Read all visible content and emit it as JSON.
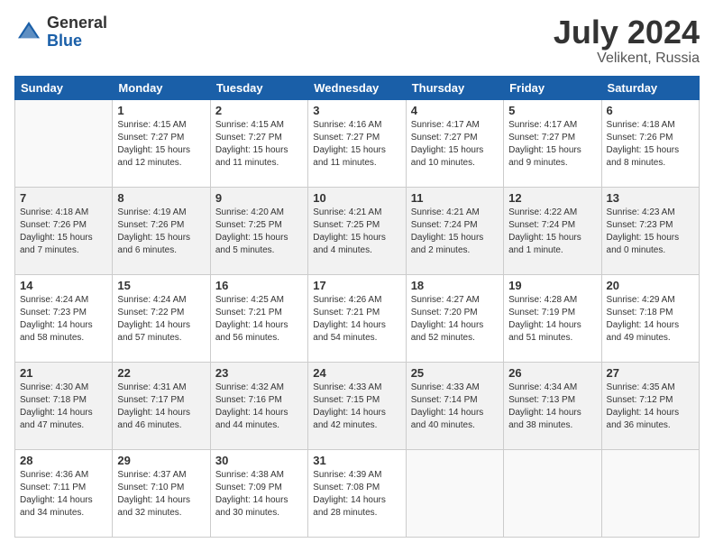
{
  "header": {
    "logo_general": "General",
    "logo_blue": "Blue",
    "title": "July 2024",
    "subtitle": "Velikent, Russia"
  },
  "days": [
    "Sunday",
    "Monday",
    "Tuesday",
    "Wednesday",
    "Thursday",
    "Friday",
    "Saturday"
  ],
  "weeks": [
    [
      {
        "day": "",
        "info": ""
      },
      {
        "day": "1",
        "info": "Sunrise: 4:15 AM\nSunset: 7:27 PM\nDaylight: 15 hours\nand 12 minutes."
      },
      {
        "day": "2",
        "info": "Sunrise: 4:15 AM\nSunset: 7:27 PM\nDaylight: 15 hours\nand 11 minutes."
      },
      {
        "day": "3",
        "info": "Sunrise: 4:16 AM\nSunset: 7:27 PM\nDaylight: 15 hours\nand 11 minutes."
      },
      {
        "day": "4",
        "info": "Sunrise: 4:17 AM\nSunset: 7:27 PM\nDaylight: 15 hours\nand 10 minutes."
      },
      {
        "day": "5",
        "info": "Sunrise: 4:17 AM\nSunset: 7:27 PM\nDaylight: 15 hours\nand 9 minutes."
      },
      {
        "day": "6",
        "info": "Sunrise: 4:18 AM\nSunset: 7:26 PM\nDaylight: 15 hours\nand 8 minutes."
      }
    ],
    [
      {
        "day": "7",
        "info": "Sunrise: 4:18 AM\nSunset: 7:26 PM\nDaylight: 15 hours\nand 7 minutes."
      },
      {
        "day": "8",
        "info": "Sunrise: 4:19 AM\nSunset: 7:26 PM\nDaylight: 15 hours\nand 6 minutes."
      },
      {
        "day": "9",
        "info": "Sunrise: 4:20 AM\nSunset: 7:25 PM\nDaylight: 15 hours\nand 5 minutes."
      },
      {
        "day": "10",
        "info": "Sunrise: 4:21 AM\nSunset: 7:25 PM\nDaylight: 15 hours\nand 4 minutes."
      },
      {
        "day": "11",
        "info": "Sunrise: 4:21 AM\nSunset: 7:24 PM\nDaylight: 15 hours\nand 2 minutes."
      },
      {
        "day": "12",
        "info": "Sunrise: 4:22 AM\nSunset: 7:24 PM\nDaylight: 15 hours\nand 1 minute."
      },
      {
        "day": "13",
        "info": "Sunrise: 4:23 AM\nSunset: 7:23 PM\nDaylight: 15 hours\nand 0 minutes."
      }
    ],
    [
      {
        "day": "14",
        "info": "Sunrise: 4:24 AM\nSunset: 7:23 PM\nDaylight: 14 hours\nand 58 minutes."
      },
      {
        "day": "15",
        "info": "Sunrise: 4:24 AM\nSunset: 7:22 PM\nDaylight: 14 hours\nand 57 minutes."
      },
      {
        "day": "16",
        "info": "Sunrise: 4:25 AM\nSunset: 7:21 PM\nDaylight: 14 hours\nand 56 minutes."
      },
      {
        "day": "17",
        "info": "Sunrise: 4:26 AM\nSunset: 7:21 PM\nDaylight: 14 hours\nand 54 minutes."
      },
      {
        "day": "18",
        "info": "Sunrise: 4:27 AM\nSunset: 7:20 PM\nDaylight: 14 hours\nand 52 minutes."
      },
      {
        "day": "19",
        "info": "Sunrise: 4:28 AM\nSunset: 7:19 PM\nDaylight: 14 hours\nand 51 minutes."
      },
      {
        "day": "20",
        "info": "Sunrise: 4:29 AM\nSunset: 7:18 PM\nDaylight: 14 hours\nand 49 minutes."
      }
    ],
    [
      {
        "day": "21",
        "info": "Sunrise: 4:30 AM\nSunset: 7:18 PM\nDaylight: 14 hours\nand 47 minutes."
      },
      {
        "day": "22",
        "info": "Sunrise: 4:31 AM\nSunset: 7:17 PM\nDaylight: 14 hours\nand 46 minutes."
      },
      {
        "day": "23",
        "info": "Sunrise: 4:32 AM\nSunset: 7:16 PM\nDaylight: 14 hours\nand 44 minutes."
      },
      {
        "day": "24",
        "info": "Sunrise: 4:33 AM\nSunset: 7:15 PM\nDaylight: 14 hours\nand 42 minutes."
      },
      {
        "day": "25",
        "info": "Sunrise: 4:33 AM\nSunset: 7:14 PM\nDaylight: 14 hours\nand 40 minutes."
      },
      {
        "day": "26",
        "info": "Sunrise: 4:34 AM\nSunset: 7:13 PM\nDaylight: 14 hours\nand 38 minutes."
      },
      {
        "day": "27",
        "info": "Sunrise: 4:35 AM\nSunset: 7:12 PM\nDaylight: 14 hours\nand 36 minutes."
      }
    ],
    [
      {
        "day": "28",
        "info": "Sunrise: 4:36 AM\nSunset: 7:11 PM\nDaylight: 14 hours\nand 34 minutes."
      },
      {
        "day": "29",
        "info": "Sunrise: 4:37 AM\nSunset: 7:10 PM\nDaylight: 14 hours\nand 32 minutes."
      },
      {
        "day": "30",
        "info": "Sunrise: 4:38 AM\nSunset: 7:09 PM\nDaylight: 14 hours\nand 30 minutes."
      },
      {
        "day": "31",
        "info": "Sunrise: 4:39 AM\nSunset: 7:08 PM\nDaylight: 14 hours\nand 28 minutes."
      },
      {
        "day": "",
        "info": ""
      },
      {
        "day": "",
        "info": ""
      },
      {
        "day": "",
        "info": ""
      }
    ]
  ]
}
